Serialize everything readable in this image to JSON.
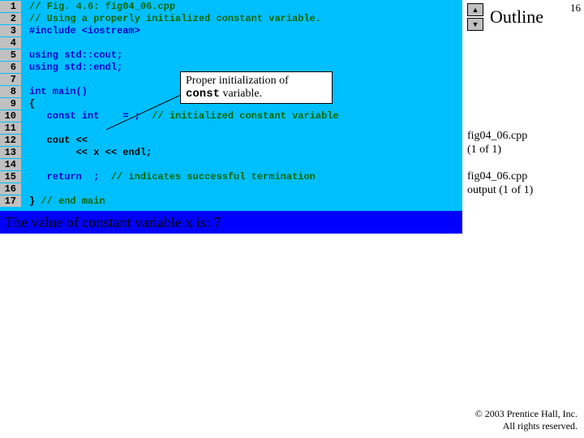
{
  "page_number": "16",
  "outline": {
    "title": "Outline"
  },
  "nav": {
    "up": "▲",
    "down": "▼"
  },
  "code": {
    "lines": [
      {
        "n": "1",
        "seg": [
          {
            "c": "c-comment",
            "t": "// Fig. 4.6: fig04_06.cpp"
          }
        ]
      },
      {
        "n": "2",
        "seg": [
          {
            "c": "c-comment",
            "t": "// Using a properly initialized constant variable."
          }
        ]
      },
      {
        "n": "3",
        "seg": [
          {
            "c": "c-pp",
            "t": "#include <iostream>"
          }
        ]
      },
      {
        "n": "4",
        "seg": []
      },
      {
        "n": "5",
        "seg": [
          {
            "c": "c-kw",
            "t": "using std::cout;"
          }
        ]
      },
      {
        "n": "6",
        "seg": [
          {
            "c": "c-kw",
            "t": "using std::endl;"
          }
        ]
      },
      {
        "n": "7",
        "seg": []
      },
      {
        "n": "8",
        "seg": [
          {
            "c": "c-kw",
            "t": "int main()"
          }
        ]
      },
      {
        "n": "9",
        "seg": [
          {
            "c": "c-plain",
            "t": "{"
          }
        ]
      },
      {
        "n": "10",
        "seg": [
          {
            "c": "c-kw",
            "t": "   const int    = ;  "
          },
          {
            "c": "c-comment",
            "t": "// initialized constant variable"
          }
        ]
      },
      {
        "n": "11",
        "seg": []
      },
      {
        "n": "12",
        "seg": [
          {
            "c": "c-plain",
            "t": "   cout << "
          }
        ]
      },
      {
        "n": "13",
        "seg": [
          {
            "c": "c-plain",
            "t": "        << x << endl;"
          }
        ]
      },
      {
        "n": "14",
        "seg": []
      },
      {
        "n": "15",
        "seg": [
          {
            "c": "c-kw",
            "t": "   return  ;  "
          },
          {
            "c": "c-comment",
            "t": "// indicates successful termination"
          }
        ]
      },
      {
        "n": "16",
        "seg": []
      },
      {
        "n": "17",
        "seg": [
          {
            "c": "c-plain",
            "t": "} "
          },
          {
            "c": "c-comment",
            "t": "// end main"
          }
        ]
      }
    ]
  },
  "callout": {
    "l1": "Proper initialization of",
    "l2a": "const",
    "l2b": " variable."
  },
  "side_labels": {
    "a1": "fig04_06.cpp",
    "a2": "(1 of 1)",
    "b1": "fig04_06.cpp",
    "b2": "output (1 of 1)"
  },
  "output_line": "The value of constant variable x is: 7",
  "copyright": {
    "l1": "© 2003 Prentice Hall, Inc.",
    "l2": "All rights reserved."
  }
}
